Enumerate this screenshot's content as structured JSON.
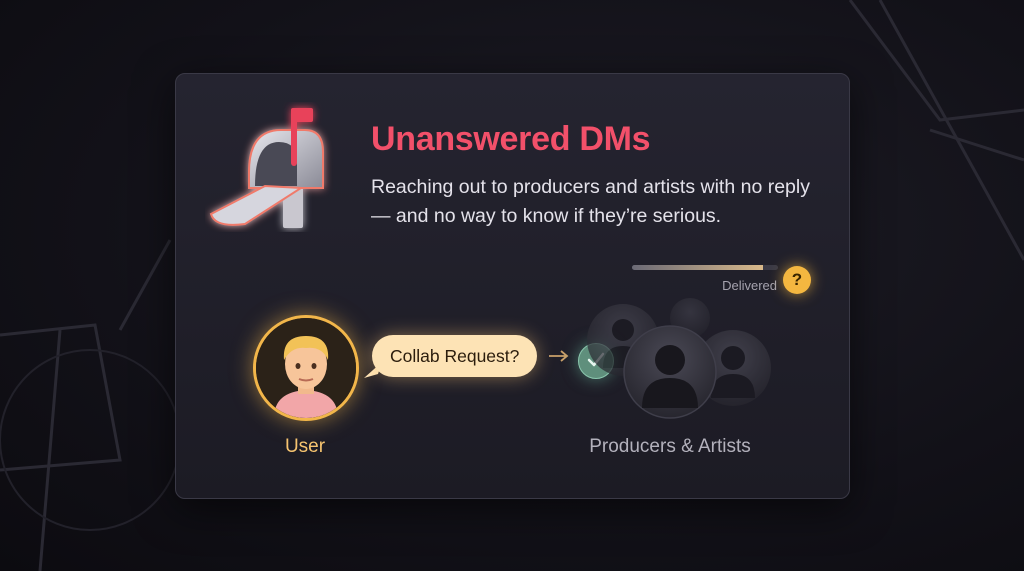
{
  "card": {
    "title": "Unanswered DMs",
    "description": "Reaching out to producers and artists with no reply — and no way to know if they’re serious."
  },
  "status": {
    "delivered_label": "Delivered",
    "delivered_progress": 0.9,
    "question_icon": "?"
  },
  "flow": {
    "user_label": "User",
    "user_avatar_icon": "man-emoji-icon",
    "message_bubble": "Collab Request?",
    "check_icon": "check-icon",
    "recipients_label": "Producers & Artists"
  },
  "colors": {
    "title": "#f2506a",
    "accent_gold": "#f4b740",
    "check_green": "#5f8f7c"
  }
}
